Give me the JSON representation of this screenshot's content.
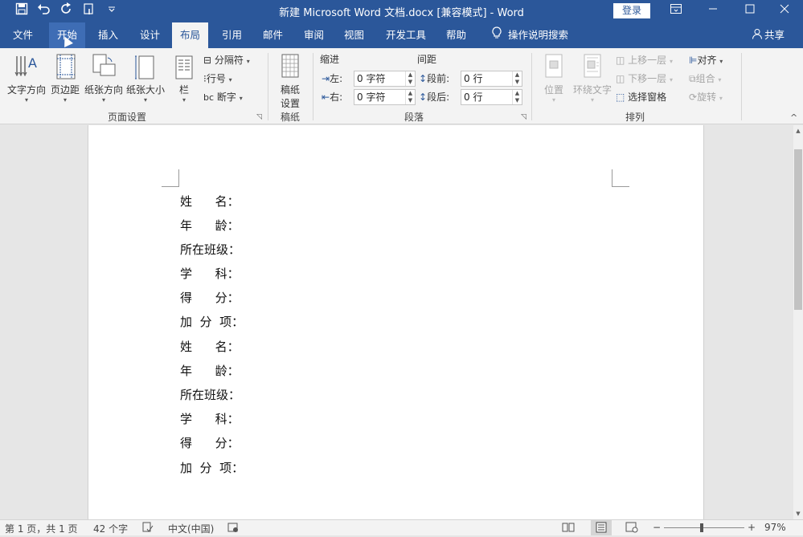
{
  "window": {
    "title": "新建 Microsoft Word 文档.docx [兼容模式]  -  Word",
    "login_label": "登录",
    "controls": [
      "ribbon-display-icon",
      "minimize-icon",
      "maximize-icon",
      "close-icon"
    ]
  },
  "quick_access": [
    "save-icon",
    "undo-icon",
    "redo-icon",
    "touch-mode-icon",
    "customize-qat-icon"
  ],
  "tabs": [
    {
      "label": "文件"
    },
    {
      "label": "开始"
    },
    {
      "label": "插入"
    },
    {
      "label": "设计"
    },
    {
      "label": "布局"
    },
    {
      "label": "引用"
    },
    {
      "label": "邮件"
    },
    {
      "label": "审阅"
    },
    {
      "label": "视图"
    },
    {
      "label": "开发工具"
    },
    {
      "label": "帮助"
    }
  ],
  "active_tab": "布局",
  "tell_me": "操作说明搜索",
  "share_label": "共享",
  "ribbon": {
    "page_setup": {
      "label": "页面设置",
      "text_direction": "文字方向",
      "margins": "页边距",
      "orientation": "纸张方向",
      "size": "纸张大小",
      "columns": "栏",
      "breaks": "分隔符",
      "line_numbers": "行号",
      "hyphenation": "断字"
    },
    "manuscript": {
      "label": "稿纸",
      "setup_line1": "稿纸",
      "setup_line2": "设置"
    },
    "paragraph": {
      "label": "段落",
      "indent_title": "缩进",
      "spacing_title": "间距",
      "left_label": "左:",
      "left_value": "0 字符",
      "right_label": "右:",
      "right_value": "0 字符",
      "before_label": "段前:",
      "before_value": "0 行",
      "after_label": "段后:",
      "after_value": "0 行"
    },
    "arrange": {
      "label": "排列",
      "position": "位置",
      "wrap_text": "环绕文字",
      "bring_forward": "上移一层",
      "send_backward": "下移一层",
      "selection_pane": "选择窗格",
      "align": "对齐",
      "group": "组合",
      "rotate": "旋转"
    }
  },
  "document": {
    "lines": [
      "姓      名：",
      "年      龄：",
      "所在班级：",
      "学      科：",
      "得      分：",
      "加  分  项：",
      "姓      名：",
      "年      龄：",
      "所在班级：",
      "学      科：",
      "得      分：",
      "加  分  项："
    ]
  },
  "status": {
    "page": "第 1 页，共 1 页",
    "words": "42 个字",
    "language": "中文(中国)",
    "zoom": "97%",
    "zoom_minus": "−",
    "zoom_plus": "+"
  }
}
